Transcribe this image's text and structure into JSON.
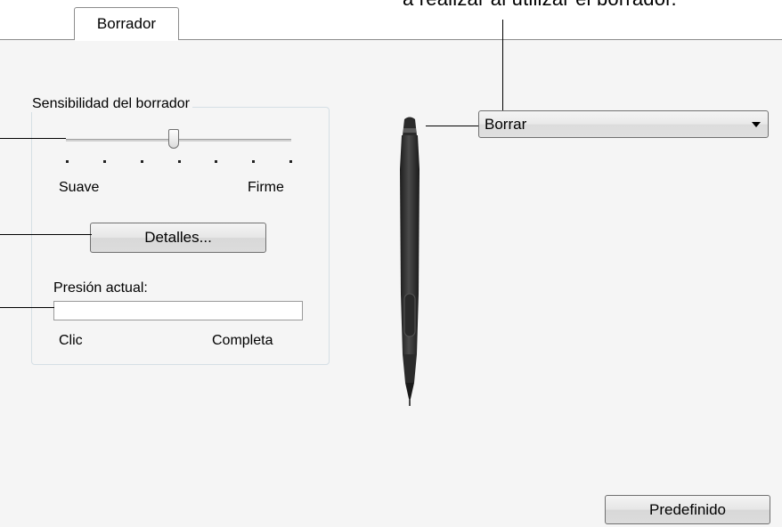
{
  "annotation": {
    "text": "a realizar al utilizar el borrador."
  },
  "tabs": [
    {
      "label": "Borrador",
      "active": true
    }
  ],
  "eraser_sensitivity": {
    "group_title": "Sensibilidad del borrador",
    "slider_level": 0.48,
    "tick_count": 7,
    "min_label": "Suave",
    "max_label": "Firme",
    "details_button": "Detalles..."
  },
  "current_pressure": {
    "label": "Presión actual:",
    "value": 0,
    "min_label": "Clic",
    "max_label": "Completa"
  },
  "eraser_function": {
    "selected": "Borrar"
  },
  "default_button": "Predefinido",
  "icons": {
    "pen": "pen-icon",
    "dropdown_arrow": "chevron-down-icon"
  },
  "colors": {
    "panel_background": "#f5f5f5",
    "group_border": "#d5dfe5",
    "pen_body": "#3a3a3a"
  }
}
